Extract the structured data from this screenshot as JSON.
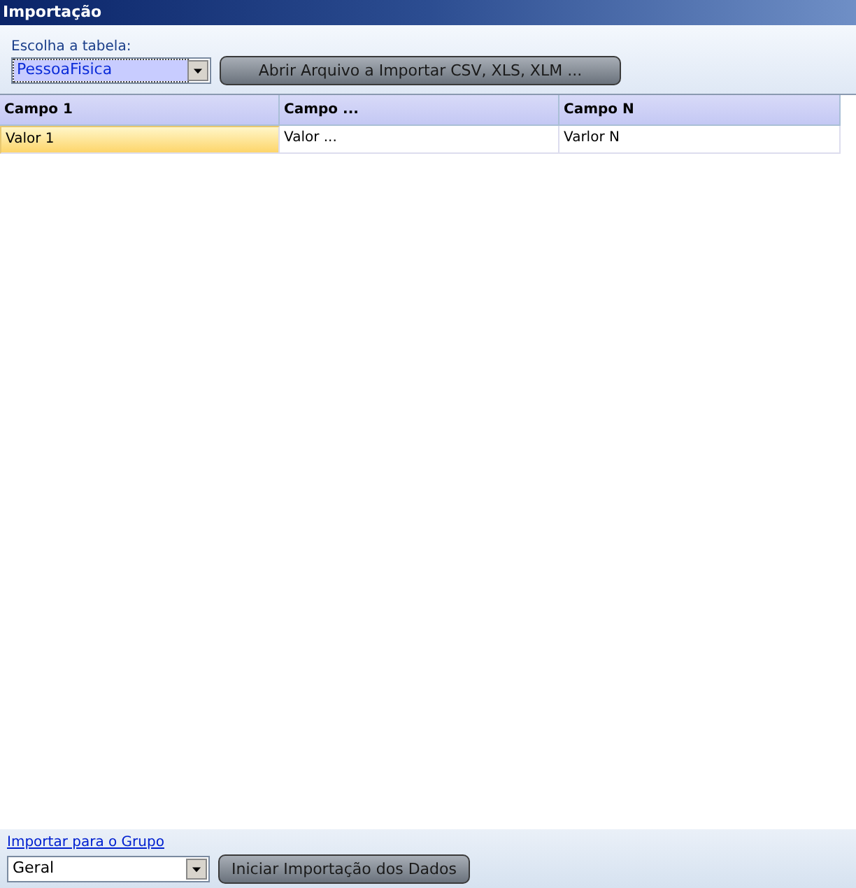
{
  "window": {
    "title": "Importação"
  },
  "table_picker": {
    "label": "Escolha a tabela:",
    "value": "PessoaFisica",
    "focused": true
  },
  "open_button": {
    "label": "Abrir Arquivo a Importar CSV, XLS, XLM ..."
  },
  "table": {
    "columns": [
      "Campo 1",
      "Campo ...",
      "Campo N"
    ],
    "rows": [
      {
        "cells": [
          {
            "text": "Valor 1",
            "selected": true
          },
          {
            "text": "Valor ...",
            "selected": false
          },
          {
            "text": "Varlor N",
            "selected": false
          }
        ]
      }
    ]
  },
  "group_link": {
    "label": "Importar para o Grupo"
  },
  "group_picker": {
    "value": "Geral",
    "focused": false
  },
  "start_button": {
    "label": "Iniciar Importação dos Dados"
  }
}
